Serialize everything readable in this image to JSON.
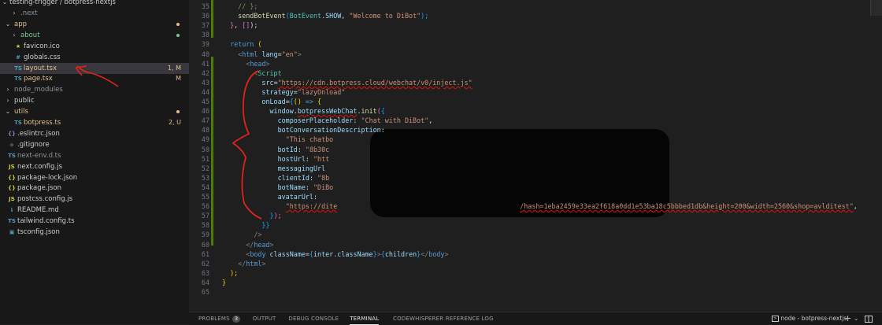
{
  "explorer": {
    "root": "testing-trigger / botpress-nextjs",
    "items": [
      {
        "name": ".next",
        "kind": "folder-closed",
        "depth": 1,
        "color": "#8b949e"
      },
      {
        "name": "app",
        "kind": "folder-open",
        "depth": 0,
        "color": "#e2c08d",
        "dot": "#e2c08d"
      },
      {
        "name": "about",
        "kind": "folder-closed",
        "depth": 1,
        "color": "#73c991",
        "dot": "#73c991"
      },
      {
        "name": "favicon.ico",
        "kind": "file",
        "icon": "★",
        "iconColor": "#cbcb41",
        "depth": 1,
        "color": "#cccccc"
      },
      {
        "name": "globals.css",
        "kind": "file",
        "icon": "#",
        "iconColor": "#519aba",
        "depth": 1,
        "color": "#cccccc"
      },
      {
        "name": "layout.tsx",
        "kind": "file",
        "icon": "TS",
        "iconColor": "#519aba",
        "depth": 1,
        "color": "#e2c08d",
        "badge": "1, M",
        "badgeColor": "#e2c08d",
        "active": true
      },
      {
        "name": "page.tsx",
        "kind": "file",
        "icon": "TS",
        "iconColor": "#519aba",
        "depth": 1,
        "color": "#e2c08d",
        "badge": "M",
        "badgeColor": "#e2c08d"
      },
      {
        "name": "node_modules",
        "kind": "folder-closed",
        "depth": 0,
        "color": "#8b949e"
      },
      {
        "name": "public",
        "kind": "folder-closed",
        "depth": 0,
        "color": "#cccccc"
      },
      {
        "name": "utils",
        "kind": "folder-open",
        "depth": 0,
        "color": "#e2c08d",
        "dot": "#e2c08d"
      },
      {
        "name": "botpress.ts",
        "kind": "file",
        "icon": "TS",
        "iconColor": "#519aba",
        "depth": 1,
        "color": "#e2c08d",
        "badge": "2, U",
        "badgeColor": "#e2c08d"
      },
      {
        "name": ".eslintrc.json",
        "kind": "file",
        "icon": "{}",
        "iconColor": "#a074c4",
        "depth": 0,
        "color": "#cccccc"
      },
      {
        "name": ".gitignore",
        "kind": "file",
        "icon": "◆",
        "iconColor": "#41535b",
        "depth": 0,
        "color": "#cccccc"
      },
      {
        "name": "next-env.d.ts",
        "kind": "file",
        "icon": "TS",
        "iconColor": "#519aba",
        "depth": 0,
        "color": "#8b949e"
      },
      {
        "name": "next.config.js",
        "kind": "file",
        "icon": "JS",
        "iconColor": "#cbcb41",
        "depth": 0,
        "color": "#cccccc"
      },
      {
        "name": "package-lock.json",
        "kind": "file",
        "icon": "{}",
        "iconColor": "#cbcb41",
        "depth": 0,
        "color": "#cccccc"
      },
      {
        "name": "package.json",
        "kind": "file",
        "icon": "{}",
        "iconColor": "#cbcb41",
        "depth": 0,
        "color": "#cccccc"
      },
      {
        "name": "postcss.config.js",
        "kind": "file",
        "icon": "JS",
        "iconColor": "#cbcb41",
        "depth": 0,
        "color": "#cccccc"
      },
      {
        "name": "README.md",
        "kind": "file",
        "icon": "ℹ",
        "iconColor": "#519aba",
        "depth": 0,
        "color": "#cccccc"
      },
      {
        "name": "tailwind.config.ts",
        "kind": "file",
        "icon": "TS",
        "iconColor": "#519aba",
        "depth": 0,
        "color": "#cccccc"
      },
      {
        "name": "tsconfig.json",
        "kind": "file",
        "icon": "▣",
        "iconColor": "#519aba",
        "depth": 0,
        "color": "#cccccc"
      }
    ]
  },
  "editor": {
    "lines": [
      {
        "n": "35",
        "tokens": [
          [
            "    ",
            ""
          ],
          [
            "// };",
            "com"
          ]
        ]
      },
      {
        "n": "36",
        "tokens": [
          [
            "    ",
            ""
          ],
          [
            "sendBotEvent",
            "fn"
          ],
          [
            "(",
            "br3"
          ],
          [
            "BotEvent",
            "comp"
          ],
          [
            ".",
            ""
          ],
          [
            "SHOW",
            "var"
          ],
          [
            ", ",
            ""
          ],
          [
            "\"Welcome to DiBot\"",
            "str"
          ],
          [
            ");",
            "br3"
          ]
        ]
      },
      {
        "n": "37",
        "tokens": [
          [
            "  ",
            ""
          ],
          [
            "}",
            "br2"
          ],
          [
            ", ",
            ""
          ],
          [
            "[]",
            "br2"
          ],
          [
            ");",
            ""
          ]
        ]
      },
      {
        "n": "38",
        "tokens": []
      },
      {
        "n": "39",
        "tokens": [
          [
            "  ",
            ""
          ],
          [
            "return",
            "kw"
          ],
          [
            " (",
            "br"
          ]
        ]
      },
      {
        "n": "40",
        "tokens": [
          [
            "    ",
            ""
          ],
          [
            "<",
            "punc"
          ],
          [
            "html",
            "tag"
          ],
          [
            " ",
            ""
          ],
          [
            "lang",
            "attr"
          ],
          [
            "=",
            ""
          ],
          [
            "\"en\"",
            "str"
          ],
          [
            ">",
            "punc"
          ]
        ]
      },
      {
        "n": "41",
        "tokens": [
          [
            "      ",
            ""
          ],
          [
            "<",
            "punc"
          ],
          [
            "head",
            "tag"
          ],
          [
            ">",
            "punc"
          ]
        ]
      },
      {
        "n": "42",
        "tokens": [
          [
            "        ",
            ""
          ],
          [
            "<",
            "punc"
          ],
          [
            "Script",
            "comp"
          ]
        ]
      },
      {
        "n": "43",
        "tokens": [
          [
            "          ",
            ""
          ],
          [
            "src",
            "attr"
          ],
          [
            "=",
            ""
          ],
          [
            "\"https://cdn.botpress.cloud/webchat/v0/inject.js\"",
            "str-sq"
          ]
        ]
      },
      {
        "n": "44",
        "tokens": [
          [
            "          ",
            ""
          ],
          [
            "strategy",
            "attr"
          ],
          [
            "=",
            ""
          ],
          [
            "\"lazyOnload\"",
            "str"
          ]
        ]
      },
      {
        "n": "45",
        "tokens": [
          [
            "          ",
            ""
          ],
          [
            "onLoad",
            "attr"
          ],
          [
            "=",
            ""
          ],
          [
            "{",
            "br3"
          ],
          [
            "() ",
            "br"
          ],
          [
            "=>",
            "kw"
          ],
          [
            " {",
            "br"
          ]
        ]
      },
      {
        "n": "46",
        "tokens": [
          [
            "            ",
            ""
          ],
          [
            "window",
            "var"
          ],
          [
            ".",
            ""
          ],
          [
            "botpressWebChat",
            "var-sq"
          ],
          [
            ".",
            ""
          ],
          [
            "init",
            "fn"
          ],
          [
            "(",
            "br2"
          ],
          [
            "{",
            "br3"
          ]
        ]
      },
      {
        "n": "47",
        "tokens": [
          [
            "              ",
            ""
          ],
          [
            "composerPlaceholder",
            "var"
          ],
          [
            ": ",
            ""
          ],
          [
            "\"Chat with DiBot\"",
            "str"
          ],
          [
            ",",
            ""
          ]
        ]
      },
      {
        "n": "48",
        "tokens": [
          [
            "              ",
            ""
          ],
          [
            "botConversationDescription",
            "var"
          ],
          [
            ":",
            ""
          ]
        ]
      },
      {
        "n": "49",
        "tokens": [
          [
            "                ",
            ""
          ],
          [
            "\"This chatbo",
            "str"
          ]
        ]
      },
      {
        "n": "50",
        "tokens": [
          [
            "              ",
            ""
          ],
          [
            "botId",
            "var"
          ],
          [
            ": ",
            ""
          ],
          [
            "\"8b30c",
            "str"
          ]
        ]
      },
      {
        "n": "51",
        "tokens": [
          [
            "              ",
            ""
          ],
          [
            "hostUrl",
            "var"
          ],
          [
            ": ",
            ""
          ],
          [
            "\"htt",
            "str"
          ]
        ]
      },
      {
        "n": "52",
        "tokens": [
          [
            "              ",
            ""
          ],
          [
            "messagingUrl",
            "var"
          ]
        ]
      },
      {
        "n": "53",
        "tokens": [
          [
            "              ",
            ""
          ],
          [
            "clientId",
            "var"
          ],
          [
            ": ",
            ""
          ],
          [
            "\"8b",
            "str"
          ]
        ]
      },
      {
        "n": "54",
        "tokens": [
          [
            "              ",
            ""
          ],
          [
            "botName",
            "var"
          ],
          [
            ": ",
            ""
          ],
          [
            "\"DiBo",
            "str"
          ]
        ]
      },
      {
        "n": "55",
        "tokens": [
          [
            "              ",
            ""
          ],
          [
            "avatarUrl",
            "var"
          ],
          [
            ":",
            ""
          ]
        ]
      },
      {
        "n": "56",
        "tokens": [
          [
            "                ",
            ""
          ],
          [
            "\"https://dite",
            "str-sq"
          ],
          [
            "                                              ",
            ""
          ],
          [
            "/hash=1eba2459e33ea2f618a0dd1e53ba18c5bbbed1db&height=200&width=2560&shop=avlditest\"",
            "str-sq"
          ],
          [
            ",",
            ""
          ]
        ]
      },
      {
        "n": "57",
        "tokens": [
          [
            "            ",
            ""
          ],
          [
            "}",
            "br3"
          ],
          [
            ");",
            "br2"
          ]
        ]
      },
      {
        "n": "58",
        "tokens": [
          [
            "          ",
            ""
          ],
          [
            "}}",
            "br3"
          ]
        ]
      },
      {
        "n": "59",
        "tokens": [
          [
            "        ",
            ""
          ],
          [
            "/>",
            "punc"
          ]
        ]
      },
      {
        "n": "60",
        "tokens": [
          [
            "      ",
            ""
          ],
          [
            "</",
            "punc"
          ],
          [
            "head",
            "tag"
          ],
          [
            ">",
            "punc"
          ]
        ]
      },
      {
        "n": "61",
        "tokens": [
          [
            "      ",
            ""
          ],
          [
            "<",
            "punc"
          ],
          [
            "body",
            "tag"
          ],
          [
            " ",
            ""
          ],
          [
            "className",
            "attr"
          ],
          [
            "=",
            ""
          ],
          [
            "{",
            "br3"
          ],
          [
            "inter",
            "var"
          ],
          [
            ".",
            ""
          ],
          [
            "className",
            "var"
          ],
          [
            "}",
            "br3"
          ],
          [
            ">",
            "punc"
          ],
          [
            "{",
            "br3"
          ],
          [
            "children",
            "var"
          ],
          [
            "}",
            "br3"
          ],
          [
            "</",
            "punc"
          ],
          [
            "body",
            "tag"
          ],
          [
            ">",
            "punc"
          ]
        ]
      },
      {
        "n": "62",
        "tokens": [
          [
            "    ",
            ""
          ],
          [
            "</",
            "punc"
          ],
          [
            "html",
            "tag"
          ],
          [
            ">",
            "punc"
          ]
        ]
      },
      {
        "n": "63",
        "tokens": [
          [
            "  ",
            ""
          ],
          [
            ");",
            "br"
          ]
        ]
      },
      {
        "n": "64",
        "tokens": [
          [
            "}",
            "br"
          ]
        ]
      },
      {
        "n": "65",
        "tokens": []
      }
    ]
  },
  "panel": {
    "tabs": [
      {
        "label": "PROBLEMS",
        "count": "3"
      },
      {
        "label": "OUTPUT"
      },
      {
        "label": "DEBUG CONSOLE"
      },
      {
        "label": "TERMINAL",
        "active": true
      },
      {
        "label": "CODEWHISPERER REFERENCE LOG"
      }
    ],
    "terminal_name": "node - botpress-nextjs",
    "add_glyph": "+",
    "chevron_glyph": "⌄"
  },
  "colors": {
    "annotation_red": "#e0241b",
    "modified_gutter": "#487e02"
  }
}
